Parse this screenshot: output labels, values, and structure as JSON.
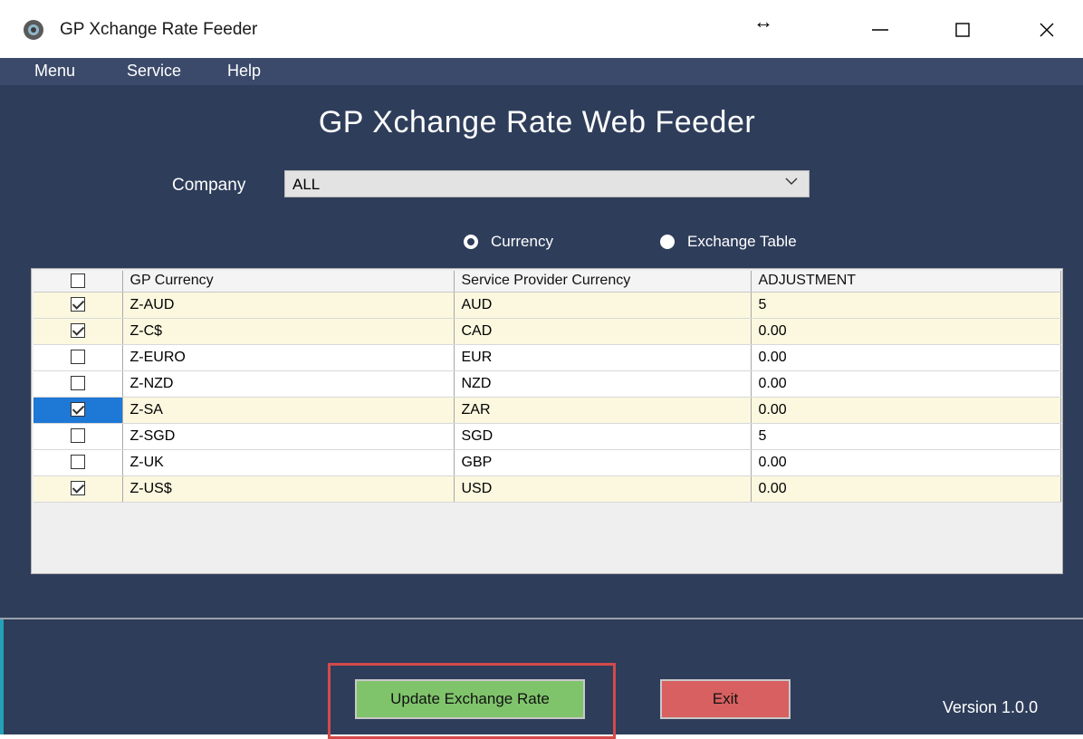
{
  "window": {
    "title": "GP Xchange Rate Feeder",
    "resize_glyph": "↔",
    "minimize_glyph": "—",
    "maximize_glyph": "☐",
    "close_glyph": "✕"
  },
  "menu": {
    "items": [
      "Menu",
      "Service",
      "Help"
    ]
  },
  "main": {
    "title": "GP Xchange Rate Web Feeder",
    "company_label": "Company",
    "company_value": "ALL",
    "radio_options": [
      {
        "label": "Currency",
        "selected": false
      },
      {
        "label": "Exchange Table",
        "selected": true
      }
    ]
  },
  "grid": {
    "headers": [
      "GP Currency",
      "Service Provider Currency",
      "ADJUSTMENT"
    ],
    "rows": [
      {
        "checked": true,
        "gp": "Z-AUD",
        "provider": "AUD",
        "adjustment": "5",
        "selected": false
      },
      {
        "checked": true,
        "gp": "Z-C$",
        "provider": "CAD",
        "adjustment": "0.00",
        "selected": false
      },
      {
        "checked": false,
        "gp": "Z-EURO",
        "provider": "EUR",
        "adjustment": "0.00",
        "selected": false
      },
      {
        "checked": false,
        "gp": "Z-NZD",
        "provider": "NZD",
        "adjustment": "0.00",
        "selected": false
      },
      {
        "checked": true,
        "gp": "Z-SA",
        "provider": "ZAR",
        "adjustment": "0.00",
        "selected": true
      },
      {
        "checked": false,
        "gp": "Z-SGD",
        "provider": "SGD",
        "adjustment": "5",
        "selected": false
      },
      {
        "checked": false,
        "gp": "Z-UK",
        "provider": "GBP",
        "adjustment": "0.00",
        "selected": false
      },
      {
        "checked": true,
        "gp": "Z-US$",
        "provider": "USD",
        "adjustment": "0.00",
        "selected": false
      }
    ]
  },
  "footer": {
    "update_label": "Update Exchange Rate",
    "exit_label": "Exit",
    "version": "Version 1.0.0"
  },
  "colors": {
    "menubar": "#3b4a6a",
    "main_bg": "#2e3d5a",
    "odd_row": "#fbf8df",
    "selected_cell": "#1e78d6",
    "update_button": "#7fc46b",
    "exit_button": "#d86060",
    "highlight": "#d44a4a"
  }
}
